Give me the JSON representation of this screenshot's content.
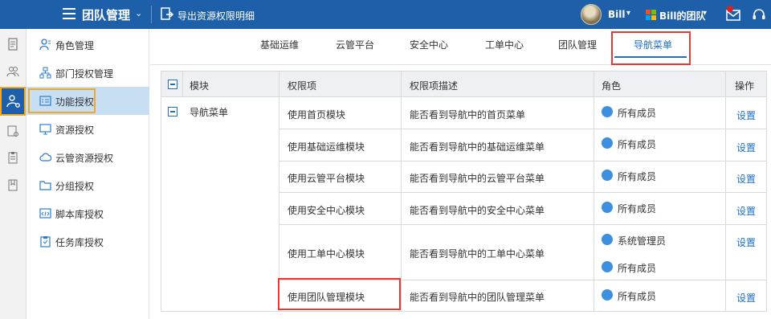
{
  "header": {
    "app_title": "团队管理",
    "export_label": "导出资源权限明细",
    "user_name": "Bill",
    "team_name": "Bill的团队",
    "icons": [
      "hamburger-icon",
      "chevron-down-icon",
      "export-icon",
      "avatar",
      "microsoft-logo",
      "mail-icon",
      "headset-icon"
    ],
    "brand_color": "#1d5fa8"
  },
  "sidebar": {
    "items": [
      {
        "label": "角色管理",
        "icon": "role-icon"
      },
      {
        "label": "部门授权管理",
        "icon": "org-chart-icon"
      },
      {
        "label": "功能授权",
        "icon": "function-icon"
      },
      {
        "label": "资源授权",
        "icon": "monitor-icon"
      },
      {
        "label": "云管资源授权",
        "icon": "cloud-icon"
      },
      {
        "label": "分组授权",
        "icon": "group-icon"
      },
      {
        "label": "脚本库授权",
        "icon": "script-icon"
      },
      {
        "label": "任务库授权",
        "icon": "task-icon"
      }
    ],
    "active_index": 2
  },
  "tabs": {
    "items": [
      "基础运维",
      "云管平台",
      "安全中心",
      "工单中心",
      "团队管理",
      "导航菜单"
    ],
    "active_index": 5
  },
  "table": {
    "headers": {
      "module": "模块",
      "permission": "权限项",
      "description": "权限项描述",
      "role": "角色",
      "action": "操作"
    },
    "module_name": "导航菜单",
    "rows": [
      {
        "permission": "使用首页模块",
        "description": "能否看到导航中的首页菜单",
        "roles": [
          "所有成员"
        ],
        "action": "设置"
      },
      {
        "permission": "使用基础运维模块",
        "description": "能否看到导航中的基础运维菜单",
        "roles": [
          "所有成员"
        ],
        "action": "设置"
      },
      {
        "permission": "使用云管平台模块",
        "description": "能否看到导航中的云管平台菜单",
        "roles": [
          "所有成员"
        ],
        "action": "设置"
      },
      {
        "permission": "使用安全中心模块",
        "description": "能否看到导航中的安全中心菜单",
        "roles": [
          "所有成员"
        ],
        "action": "设置"
      },
      {
        "permission": "使用工单中心模块",
        "description": "能否看到导航中的工单中心菜单",
        "roles": [
          "系统管理员",
          "所有成员"
        ],
        "action": "设置"
      },
      {
        "permission": "使用团队管理模块",
        "description": "能否看到导航中的团队管理菜单",
        "roles": [
          "所有成员"
        ],
        "action": "设置"
      }
    ]
  }
}
